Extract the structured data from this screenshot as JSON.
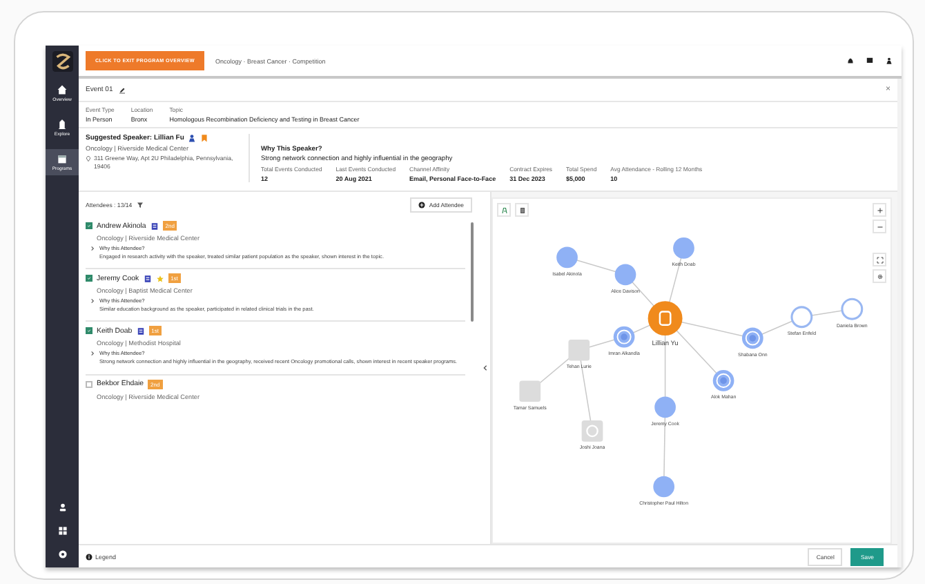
{
  "sidebar": {
    "items": [
      {
        "label": "Overview",
        "selected": false
      },
      {
        "label": "Explore",
        "selected": false
      },
      {
        "label": "Programs",
        "selected": true
      }
    ]
  },
  "top_bar": {
    "exit_button": "CLICK TO EXIT PROGRAM OVERVIEW",
    "breadcrumb": "Oncology · Breast Cancer · Competition"
  },
  "event": {
    "title": "Event 01",
    "close": "×",
    "fields": [
      {
        "label": "Event Type",
        "value": "In Person"
      },
      {
        "label": "Location",
        "value": "Bronx"
      },
      {
        "label": "Topic",
        "value": "Homologous Recombination Deficiency and Testing in Breast Cancer"
      }
    ]
  },
  "speaker": {
    "heading": "Suggested Speaker: Lillian Fu",
    "affiliation": "Oncology | Riverside Medical Center",
    "address": "311 Greene Way, Apt 2U Philadelphia, Pennsylvania, 19406",
    "why_heading": "Why This Speaker?",
    "why_text": "Strong network connection and highly influential in the geography",
    "stats": [
      {
        "label": "Total Events Conducted",
        "value": "12"
      },
      {
        "label": "Last Events Conducted",
        "value": "20 Aug 2021"
      },
      {
        "label": "Channel Affinity",
        "value": "Email, Personal Face-to-Face"
      },
      {
        "label": "Contract Expires",
        "value": "31 Dec 2023"
      },
      {
        "label": "Total Spend",
        "value": "$5,000"
      },
      {
        "label": "Avg Attendance - Rolling 12 Months",
        "value": "10"
      }
    ]
  },
  "attendees": {
    "label": "Attendees : 13/14",
    "add_button": "Add Attendee",
    "items": [
      {
        "name": "Andrew Akinola",
        "checked": true,
        "verified": true,
        "starred": false,
        "degree": "2nd",
        "affiliation": "Oncology | Riverside Medical Center",
        "why_label": "Why this Attendee?",
        "reason": "Engaged in research activity with the speaker, treated similar patient population as the speaker, shown interest in the topic."
      },
      {
        "name": "Jeremy Cook",
        "checked": true,
        "verified": true,
        "starred": true,
        "degree": "1st",
        "affiliation": "Oncology | Baptist Medical Center",
        "why_label": "Why this Attendee?",
        "reason": "Similar education background as the speaker, participated in related clinical trials in the past."
      },
      {
        "name": "Keith Doab",
        "checked": true,
        "verified": true,
        "starred": false,
        "degree": "1st",
        "affiliation": "Oncology | Methodist Hospital",
        "why_label": "Why this Attendee?",
        "reason": "Strong network connection and highly influential in the geography, received recent Oncology promotional calls, shown interest in recent speaker programs."
      },
      {
        "name": "Bekbor Ehdaie",
        "checked": false,
        "verified": false,
        "starred": false,
        "degree": "2nd",
        "affiliation": "Oncology | Riverside Medical Center"
      }
    ]
  },
  "network": {
    "root": {
      "name": "Lillian Yu",
      "kind": "speaker",
      "children": [
        {
          "name": "Alice Davison",
          "kind": "filled",
          "children": [
            {
              "name": "Isabel Akinola",
              "kind": "filled"
            }
          ]
        },
        {
          "name": "Keith Doab",
          "kind": "filled"
        },
        {
          "name": "Imran Alkandla",
          "kind": "ring",
          "children": [
            {
              "name": "Tehan Lurie",
              "kind": "gray",
              "children": [
                {
                  "name": "Tamar Samuels",
                  "kind": "gray"
                },
                {
                  "name": "Joshi Joana",
                  "kind": "gray-ring"
                }
              ]
            }
          ]
        },
        {
          "name": "Shabana Onn",
          "kind": "ring",
          "children": [
            {
              "name": "Stefan Enfeld",
              "kind": "outline",
              "children": [
                {
                  "name": "Daniela Brown",
                  "kind": "outline"
                }
              ]
            }
          ]
        },
        {
          "name": "Alok Mahan",
          "kind": "ring"
        },
        {
          "name": "Jeremy Cook",
          "kind": "filled",
          "children": [
            {
              "name": "Christopher Paul Hilton",
              "kind": "filled"
            }
          ]
        }
      ]
    }
  },
  "footer": {
    "legend": "Legend",
    "cancel": "Cancel",
    "save": "Save"
  }
}
